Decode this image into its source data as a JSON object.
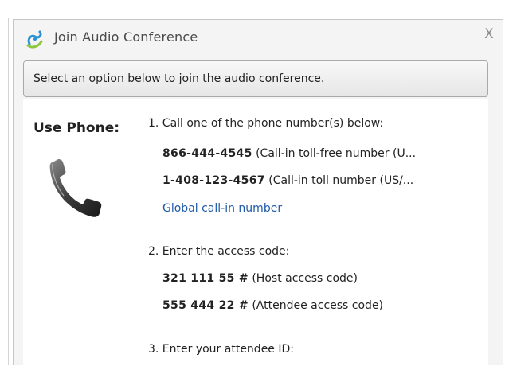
{
  "dialog": {
    "title": "Join Audio Conference",
    "close_label": "X"
  },
  "banner": {
    "text": "Select an option below to join the audio conference."
  },
  "phone": {
    "heading": "Use Phone:",
    "icon": "phone-handset-icon"
  },
  "steps": {
    "step1": {
      "label": "1. Call one of the phone number(s) below:",
      "numbers": [
        {
          "number": "866-444-4545",
          "description": "(Call-in toll-free number (U..."
        },
        {
          "number": "1-408-123-4567",
          "description": "(Call-in toll number (US/..."
        }
      ],
      "global_link": "Global call-in number"
    },
    "step2": {
      "label": "2. Enter the access code:",
      "codes": [
        {
          "code": "321 111 55 #",
          "description": "(Host access code)"
        },
        {
          "code": "555 444 22 #",
          "description": "(Attendee access code)"
        }
      ]
    },
    "step3": {
      "label": "3. Enter your attendee ID:"
    }
  },
  "colors": {
    "link": "#1e5aa8",
    "dialog_background": "#f4f4f4",
    "content_background": "#ffffff"
  }
}
